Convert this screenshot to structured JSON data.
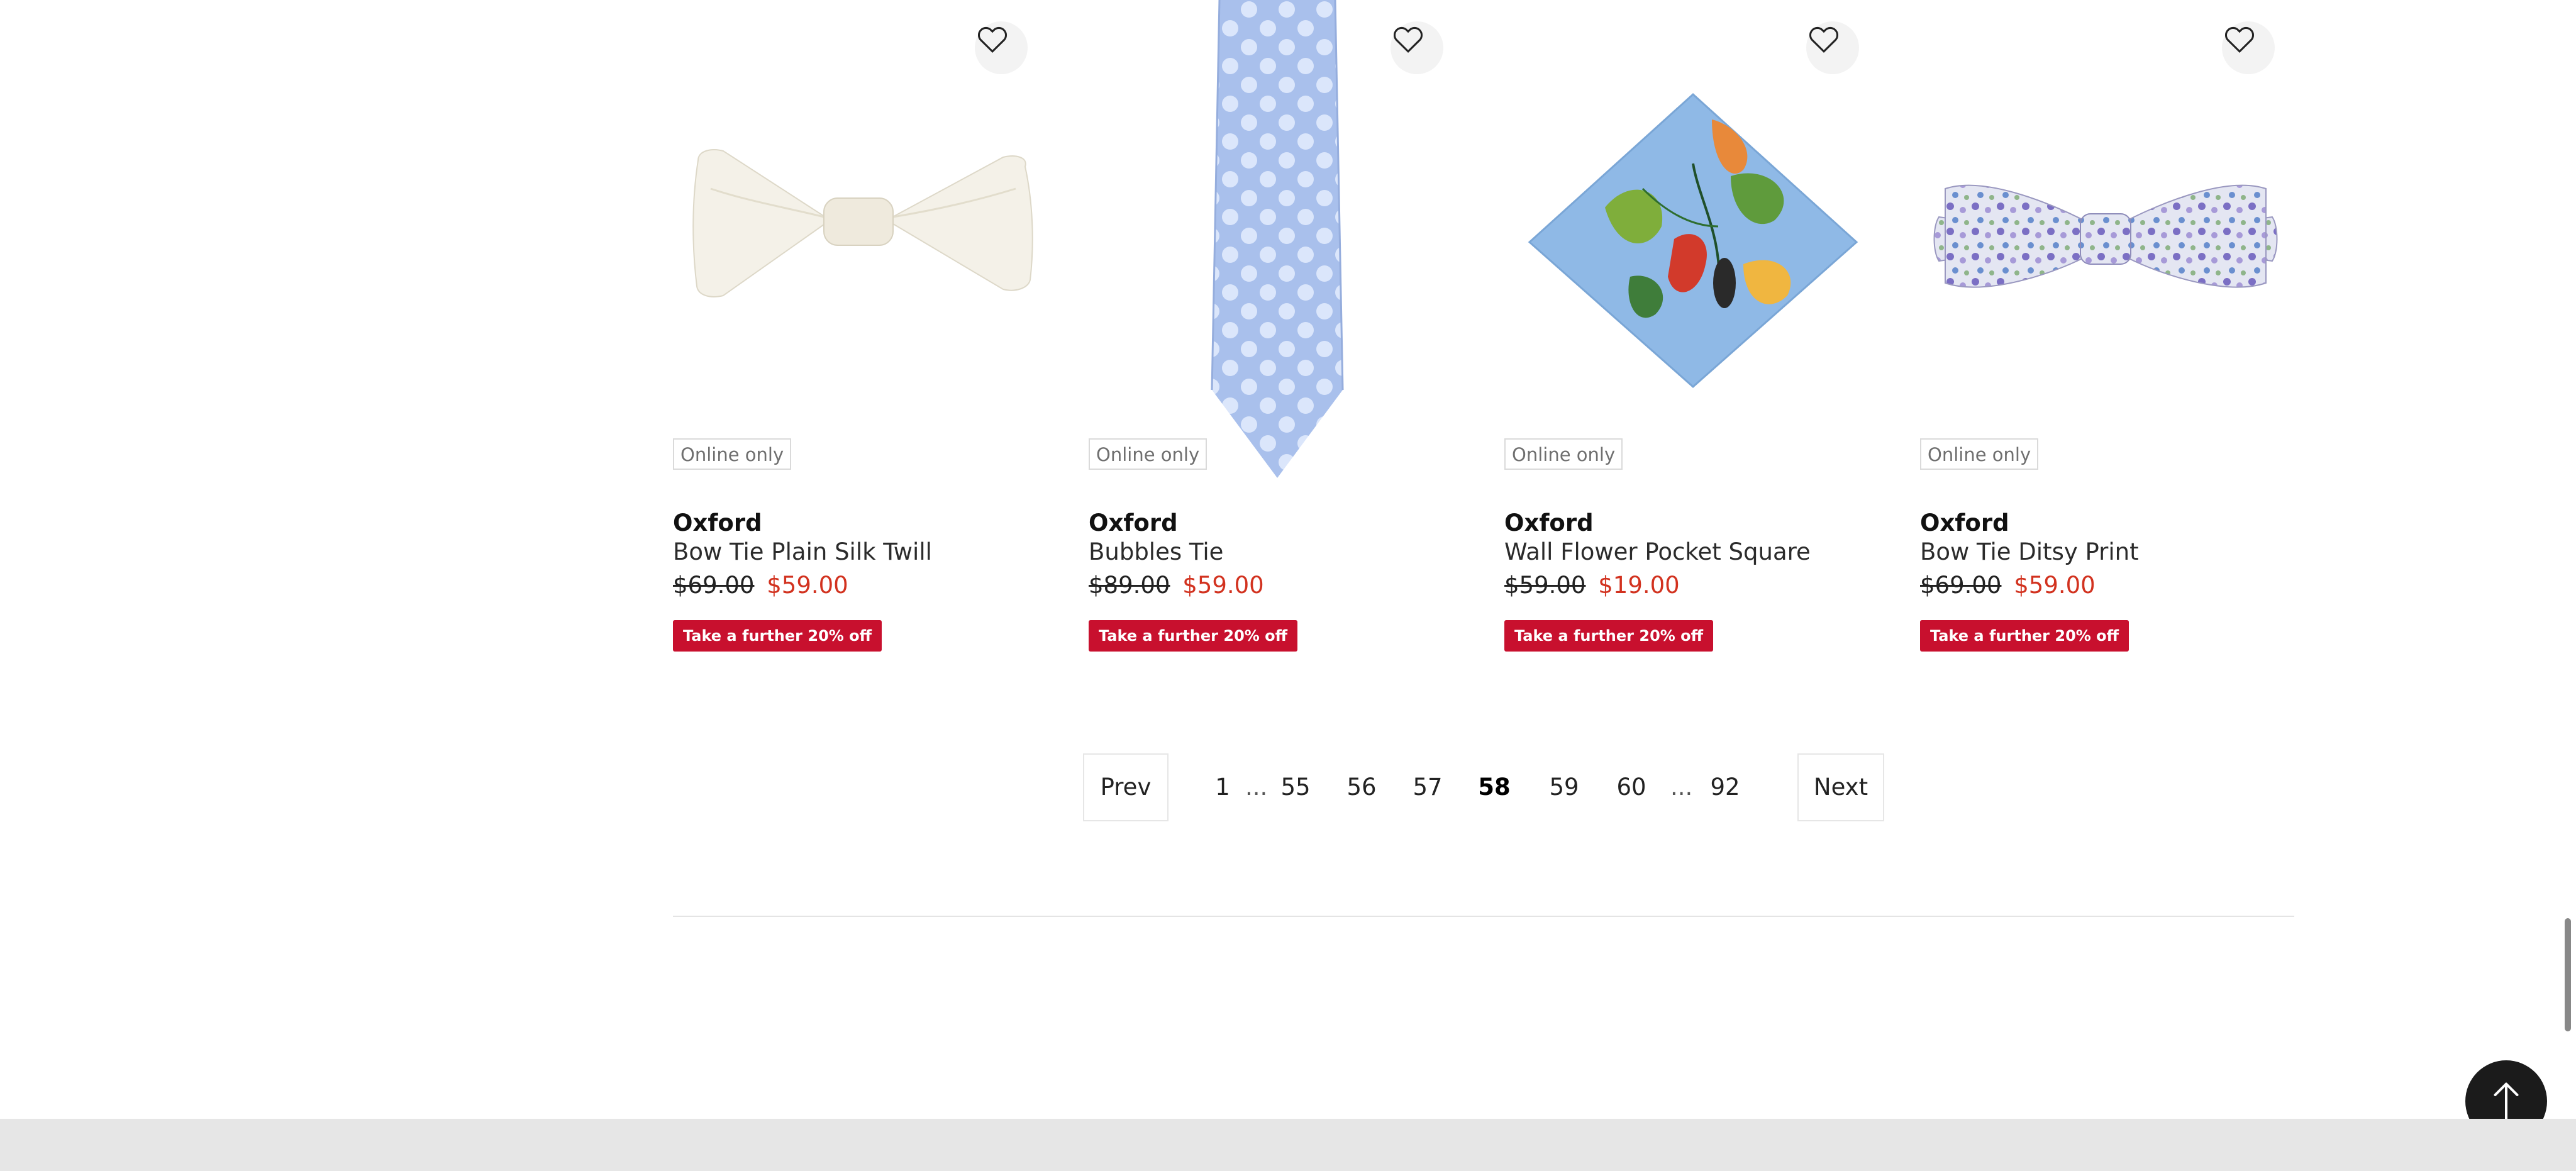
{
  "products": [
    {
      "badge": "Online only",
      "brand": "Oxford",
      "name": "Bow Tie Plain Silk Twill",
      "price_was": "$69.00",
      "price_now": "$59.00",
      "promo": "Take a further 20% off",
      "image_icon": "white-bow-tie"
    },
    {
      "badge": "Online only",
      "brand": "Oxford",
      "name": "Bubbles Tie",
      "price_was": "$89.00",
      "price_now": "$59.00",
      "promo": "Take a further 20% off",
      "image_icon": "blue-polka-dot-tie"
    },
    {
      "badge": "Online only",
      "brand": "Oxford",
      "name": "Wall Flower Pocket Square",
      "price_was": "$59.00",
      "price_now": "$19.00",
      "promo": "Take a further 20% off",
      "image_icon": "floral-pocket-square"
    },
    {
      "badge": "Online only",
      "brand": "Oxford",
      "name": "Bow Tie Ditsy Print",
      "price_was": "$69.00",
      "price_now": "$59.00",
      "promo": "Take a further 20% off",
      "image_icon": "floral-bow-tie"
    }
  ],
  "pagination": {
    "prev_label": "Prev",
    "next_label": "Next",
    "pages": [
      "1",
      "55",
      "56",
      "57",
      "58",
      "59",
      "60",
      "92"
    ],
    "ellipsis": "...",
    "current": "58"
  },
  "icons": {
    "wishlist": "heart-outline-icon",
    "back_to_top": "arrow-up-icon"
  },
  "colors": {
    "sale_price": "#d2321f",
    "promo_bg": "#c8102e",
    "back_to_top_bg": "#1b1b1b",
    "footer_bg": "#e6e6e6"
  }
}
